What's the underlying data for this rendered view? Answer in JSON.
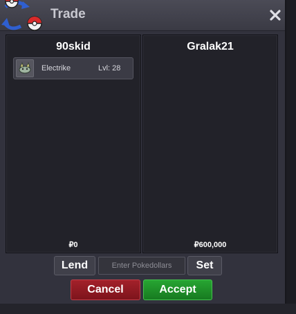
{
  "window": {
    "title": "Trade"
  },
  "trade": {
    "left": {
      "player": "90skid",
      "money": "₽0",
      "items": [
        {
          "name": "Electrike",
          "level": "Lvl: 28"
        }
      ]
    },
    "right": {
      "player": "Gralak21",
      "money": "₽600,000"
    }
  },
  "controls": {
    "lend_label": "Lend",
    "money_placeholder": "Enter Pokedollars",
    "set_label": "Set",
    "cancel_label": "Cancel",
    "accept_label": "Accept"
  },
  "colors": {
    "cancel": "#a3212a",
    "accept": "#27a532",
    "panel_bg": "#222229"
  }
}
